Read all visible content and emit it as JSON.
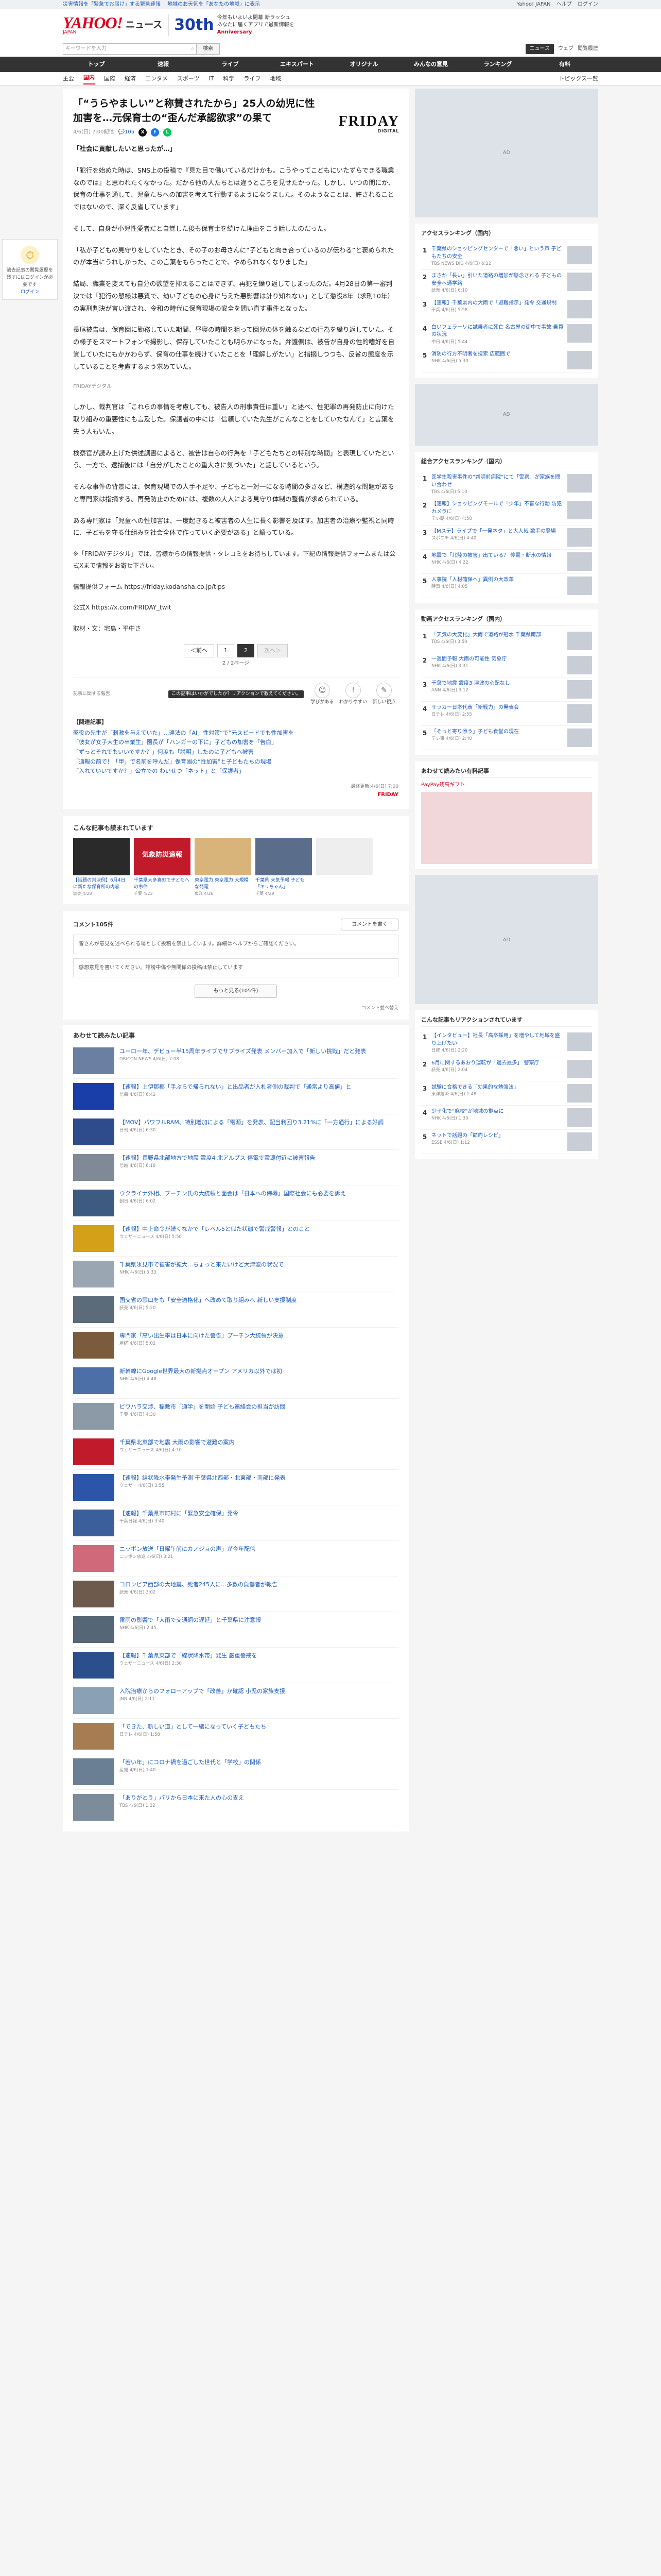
{
  "topbar": {
    "left": [
      "災害情報を「緊急でお届け」する緊急速報",
      "地域のお天気を「あなたの地域」に表示"
    ],
    "right": [
      "Yahoo! JAPAN",
      "ヘルプ",
      "ログイン"
    ]
  },
  "header": {
    "logo": "YAHOO!",
    "logo_sub": "JAPAN",
    "news_word": "ニュース",
    "anniv_num": "30th",
    "anniv_line1": "今年もいよいよ開幕 新ラッシュ",
    "anniv_line2": "あなたに届くアプリで最新情報を",
    "anniv_brand": "Anniversary"
  },
  "search": {
    "placeholder": "キーワードを入力",
    "button": "検索",
    "right_items": [
      "ニュース",
      "ウェブ"
    ],
    "right_active": "ニュース",
    "right_login": "閲覧履歴"
  },
  "catnav": [
    {
      "label": "トップ",
      "active": false
    },
    {
      "label": "速報",
      "active": false
    },
    {
      "label": "ライブ",
      "active": false
    },
    {
      "label": "エキスパート",
      "active": false
    },
    {
      "label": "オリジナル",
      "active": false
    },
    {
      "label": "みんなの意見",
      "active": false
    },
    {
      "label": "ランキング",
      "active": false
    },
    {
      "label": "有料",
      "active": false
    }
  ],
  "subnav": {
    "items": [
      "主要",
      "国内",
      "国際",
      "経済",
      "エンタメ",
      "スポーツ",
      "IT",
      "科学",
      "ライフ",
      "地域"
    ],
    "active": "国内",
    "right": "トピックス一覧"
  },
  "leftwid": {
    "title": "ログイン",
    "text": "過去記事の閲覧履歴を残すにはログインが必要です",
    "link": "ログイン"
  },
  "article": {
    "title": "「“うらやましい”と称賛されたから」25人の幼児に性加害を…元保育士の“歪んだ承認欲求”の果て",
    "brand": "FRIDAY",
    "brand_sub": "DIGITAL",
    "date": "4/6(日) 7:00配信",
    "comments": "105",
    "body": [
      {
        "type": "lead",
        "text": "「社会に貢献したいと思ったが…」"
      },
      {
        "type": "p",
        "text": "「犯行を始めた時は、SNS上の投稿で『見た目で働いているだけかも。こうやってこどもにいたずらできる職業なのでは』と思われたくなかった。だから他の人たちとは違うところを見せたかった。しかし、いつの間にか、保育の仕事を通して、児童たちへの加害を考えて行動するようになりました。そのようなことは、許されることではないので、深く反省しています」"
      },
      {
        "type": "p",
        "text": "そして、自身が小児性愛者だと自覚した後も保育士を続けた理由をこう話したのだった。"
      },
      {
        "type": "p",
        "text": "「私が子どもの見守りをしていたとき、その子のお母さんに“子どもと向き合っているのが伝わる”と褒められたのが本当にうれしかった。この言葉をもらったことで、やめられなくなりました」"
      },
      {
        "type": "p",
        "text": "結局、職業を変えても自分の欲望を抑えることはできず、再犯を繰り返してしまったのだ。4月28日の第一審判決では「犯行の態様は悪質で、幼い子どもの心身に与えた悪影響は計り知れない」として懲役8年（求刑10年）の実刑判決が言い渡され、令和の時代に保育現場の安全を問い直す事件となった。"
      },
      {
        "type": "p",
        "text": "長尾被告は、保育園に勤務していた期間、昼寝の時間を狙って園児の体を触るなどの行為を繰り返していた。その様子をスマートフォンで撮影し、保存していたことも明らかになった。弁護側は、被告が自身の性的嗜好を自覚していたにもかかわらず、保育の仕事を続けていたことを「理解しがたい」と指摘しつつも、反省の態度を示していることを考慮するよう求めていた。"
      },
      {
        "type": "p",
        "text": "しかし、裁判官は「これらの事情を考慮しても、被告人の刑事責任は重い」と述べ、性犯罪の再発防止に向けた取り組みの重要性にも言及した。保護者の中には「信頼していた先生がこんなことをしていたなんて」と言葉を失う人もいた。"
      },
      {
        "type": "p",
        "text": "検察官が読み上げた供述調書によると、被告は自らの行為を「子どもたちとの特別な時間」と表現していたという。一方で、逮捕後には「自分がしたことの重大さに気づいた」と話しているという。"
      },
      {
        "type": "p",
        "text": "そんな事件の背景には、保育現場での人手不足や、子どもと一対一になる時間の多さなど、構造的な問題があると専門家は指摘する。再発防止のためには、複数の大人による見守り体制の整備が求められている。"
      },
      {
        "type": "p",
        "text": "ある専門家は「児童への性加害は、一度起きると被害者の人生に長く影響を及ぼす。加害者の治療や監視と同時に、子どもを守る仕組みを社会全体で作っていく必要がある」と語っている。"
      },
      {
        "type": "q",
        "text": "※「FRIDAYデジタル」では、皆様からの情報提供・タレコミをお待ちしています。下記の情報提供フォームまたは公式Xまで情報をお寄せ下さい。"
      },
      {
        "type": "q",
        "text": "情報提供フォーム https://friday.kodansha.co.jp/tips"
      },
      {
        "type": "q",
        "text": "公式X https://x.com/FRIDAY_twit"
      },
      {
        "type": "q",
        "text": "取材・文：宅島・平中さ"
      }
    ],
    "photo_caption": "FRIDAYデジタル",
    "pager": {
      "prev": "＜前へ",
      "pages": [
        "1",
        "2"
      ],
      "current": "2",
      "next": "次へ＞",
      "count": "2 / 2ページ"
    },
    "report_link": "記事に関する報告",
    "reaction_tip": "この記事はいかがでしたか？リアクションで教えてください。",
    "reactions": [
      {
        "icon": "☺",
        "label": "学びがある"
      },
      {
        "icon": "!",
        "label": "わかりやすい"
      },
      {
        "icon": "✎",
        "label": "新しい視点"
      }
    ],
    "related_title": "【関連記事】",
    "related": [
      "懲役の先生が「刺激を与えていた」…違法の「AI」性対策“で”元スピードでも性加害を",
      "「彼女が女子大生の卒業生」園長が「ハンガーの下に」子どもの加害を「告白」",
      "「ずっとそれでもいいですか？」何度も「説明」したのに子どもへ被害",
      "「通報の前で！「甲」で名前を呼んだ」保育園の“性加害”と子どもたちの現場",
      "「入れていいですか？」公立での  わいせつ「ネット」と「保護者」"
    ],
    "credit_label": "最終更新:4/6(日) 7:00",
    "credit_brand": "FRIDAY"
  },
  "recommend": {
    "title": "こんな記事も読まれています",
    "cards": [
      {
        "text": "【話題の判決例】6月4日に新たな保育所の内容",
        "src": "読売 4/28",
        "color": "#2a2a2a"
      },
      {
        "text": "千葉県大多喜町で子どもへの事件",
        "src": "千葉 4/23",
        "color": "#c11a2a"
      },
      {
        "text": "東京電力 東京電力 大規模な発電",
        "src": "東洋 4/26",
        "color": "#d9b47a"
      },
      {
        "text": "千葉県 天気予報 子ども「キリちゃん」",
        "src": "千葉 4/29",
        "color": "#5a6e8c"
      },
      {
        "text": "",
        "src": "",
        "color": "#eeeeee"
      }
    ],
    "disaster_label": "気象防災速報"
  },
  "comments_sec": {
    "title": "コメント105件",
    "write_btn": "コメントを書く",
    "notice": "皆さんが意見を述べられる場として投稿を禁止しています。詳細はヘルプからご確認ください。",
    "input_placeholder": "感想意見を書いてください。誹謗中傷や無関係の投稿は禁止しています",
    "more_btn": "もっと見る(105件)",
    "sort": "コメント並べ替え"
  },
  "feed": {
    "title": "あわせて読みたい記事",
    "items": [
      {
        "text": "ユーロ一年、デビュー半15周年ライブでサプライズ発表 メンバー加入で「新しい挑戦」だと発表",
        "src": "ORICON NEWS 4/6(日) 7:08",
        "color": "#6b7fa3"
      },
      {
        "text": "【速報】上伊那郡「手ぶらで帰られない」と出品者が入札者側の裁判で「通常より高値」と",
        "src": "信毎 4/6(日) 6:42",
        "color": "#1a3ea8"
      },
      {
        "text": "【MOV】パワフルRAM、特別増加による「電源」を発表、配当利回り3.21%に「一方通行」による好調",
        "src": "日刊 4/6(日) 6:30",
        "color": "#2e4c8c"
      },
      {
        "text": "【速報】長野県北部地方で地震 震度4 北アルプス 停電で震源付近に被害報告",
        "src": "信越 4/6(日) 6:18",
        "color": "#7f8a96"
      },
      {
        "text": "ウクライナ外相、プーチン氏の大統領と面会は「日本への侮辱」国際社会にも必要を訴え",
        "src": "朝日 4/6(日) 6:02",
        "color": "#3d5a80"
      },
      {
        "text": "【速報】中止命令が続くなかで「レベル5と似た状態で警戒警報」とのこと",
        "src": "ウェザーニュース 4/6(日) 5:50",
        "color": "#d4a017"
      },
      {
        "text": "千葉県氷見市で被害が拡大…ちょっと来たいけど大津波の状況で",
        "src": "NHK 4/6(日) 5:33",
        "color": "#9aa6b2"
      },
      {
        "text": "国交省の窓口をも「安全適格化」へ改めて取り組みへ 新しい支援制度",
        "src": "読売 4/6(日) 5:20",
        "color": "#5c6b7a"
      },
      {
        "text": "専門家「高い出生率は日本に向けた警告」プーチン大統領が決意",
        "src": "産経 4/6(日) 5:02",
        "color": "#7a5c3d"
      },
      {
        "text": "新幹線にGoogle世界最大の新拠点オープン アメリカ以外では初",
        "src": "NHK 4/6(日) 4:48",
        "color": "#4c6fa8"
      },
      {
        "text": "ビワハラ交渉、稲敷市「通学」を開始 子ども連絡会の担当が訪問",
        "src": "千葉 4/6(日) 4:30",
        "color": "#8c9aa8"
      },
      {
        "text": "千葉県北東部で地震 大雨の影響で避難の案内",
        "src": "ウェザーニュース 4/6(日) 4:10",
        "color": "#c11a2a"
      },
      {
        "text": "【速報】線状降水帯発生予測 千葉県北西部・北東部・南部に発表",
        "src": "ウェザー 4/6(日) 3:55",
        "color": "#2a55a8"
      },
      {
        "text": "【速報】千葉県市町村に「緊急安全確保」発令",
        "src": "千葉日報 4/6(日) 3:40",
        "color": "#3a5f9a"
      },
      {
        "text": "ニッポン放送「日曜午前にカノジョの声」が今年配信",
        "src": "ニッポン放送 4/6(日) 3:21",
        "color": "#d06a7a"
      },
      {
        "text": "コロンビア西部の大地震、死者245人に…多数の負傷者が報告",
        "src": "読売 4/6(日) 3:02",
        "color": "#6e5a4c"
      },
      {
        "text": "雷雨の影響で「大雨で交通網の遅延」と千葉県に注意報",
        "src": "NHK 4/6(日) 2:45",
        "color": "#556677"
      },
      {
        "text": "【速報】千葉県東部で「線状降水帯」発生 厳重警戒を",
        "src": "ウェザーニュース 4/6(日) 2:30",
        "color": "#2b4f8c"
      },
      {
        "text": "入院治療からのフォローアップで「改善」か確認 小児の家族支援",
        "src": "JNN 4/6(日) 2:11",
        "color": "#8aa0b5"
      },
      {
        "text": "「できた、新しい道」として一緒になっていく子どもたち",
        "src": "日テレ 4/6(日) 1:58",
        "color": "#a67c52"
      },
      {
        "text": "「若い年」にコロナ禍を過ごした世代と「学校」の関係",
        "src": "産経 4/6(日) 1:40",
        "color": "#6a7f94"
      },
      {
        "text": "「ありがとう」パリから日本に来た人の心の支え",
        "src": "TBS 4/6(日) 1:22",
        "color": "#7d8c9b"
      }
    ]
  },
  "side": {
    "ranking_title": "アクセスランキング（国内）",
    "ranking": [
      {
        "t": "千葉県のショッピングセンターで「悪い」という声 子どもたちの安全",
        "src": "TBS NEWS DIG 4/6(日) 6:22"
      },
      {
        "t": "まさか「長い」引いた道路の増加が懸念される 子どもの安全へ通学路",
        "src": "読売 4/6(日) 6:10"
      },
      {
        "t": "【速報】千葉県内の大雨で「避難指示」発令 交通規制",
        "src": "千葉 4/6(日) 5:58"
      },
      {
        "t": "白いフェラーリに試乗者に死亡 名古屋の街中で事故 乗員の状況",
        "src": "中日 4/6(日) 5:44"
      },
      {
        "t": "消防の行方不明者を捜索 広範囲で",
        "src": "NHK 4/6(日) 5:30"
      }
    ],
    "ranking2_title": "総合アクセスランキング（国内）",
    "ranking2": [
      {
        "t": "医学生殺害事件の“判明前病院”にて「警察」が家族を問い合わせ",
        "src": "TBS 4/6(日) 5:10"
      },
      {
        "t": "【速報】ショッピングモールで「少年」不審な行動 防犯カメラに",
        "src": "テレ朝 4/6(日) 4:58"
      },
      {
        "t": "【Mステ】ライブで「一発ネタ」と大人気 歌手の登場",
        "src": "スポニチ 4/6(日) 4:40"
      },
      {
        "t": "地震で「北陸の被害」出ている？ 停電・断水の情報",
        "src": "NHK 4/6(日) 4:22"
      },
      {
        "t": "人事院「人材確保へ」異例の大改革",
        "src": "時事 4/6(日) 4:05"
      }
    ],
    "ranking3_title": "動画アクセスランキング（国内）",
    "ranking3": [
      {
        "t": "「天気の大変化」大雨で道路が冠水 千葉県南部",
        "src": "TBS 4/6(日) 3:50"
      },
      {
        "t": "一週間予報 大雨の可能性 気象庁",
        "src": "NHK 4/6(日) 3:31"
      },
      {
        "t": "千葉で地震 震度3 津波の心配なし",
        "src": "ANN 4/6(日) 3:12"
      },
      {
        "t": "サッカー日本代表「新戦力」の発表会",
        "src": "日テレ 4/6(日) 2:55"
      },
      {
        "t": "「そっと寄り添う」子ども食堂の現在",
        "src": "テレ東 4/6(日) 2:40"
      }
    ],
    "paypay_title": "あわせて読みたい有料記事",
    "paypay_label": "PayPay残高ギフト",
    "ranking4_title": "こんな記事もリアクションされています",
    "ranking4": [
      {
        "t": "【インタビュー】社長「高卒採用」を増やして地域を盛り上げたい",
        "src": "日経 4/6(日) 2:20"
      },
      {
        "t": "6月に関するあおり運転が「過去最多」 警察庁",
        "src": "読売 4/6(日) 2:04"
      },
      {
        "t": "試験に合格できる「効果的な勉強法」",
        "src": "東洋経済 4/6(日) 1:48"
      },
      {
        "t": "少子化で“廃校”が地域の拠点に",
        "src": "NHK 4/6(日) 1:30"
      },
      {
        "t": "ネットで話題の「節約レシピ」",
        "src": "ESSE 4/6(日) 1:12"
      }
    ]
  }
}
